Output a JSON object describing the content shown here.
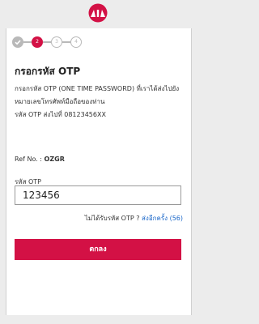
{
  "brand": {
    "accent": "#d31145",
    "link": "#1a67c9",
    "logo": "aia-logo-icon"
  },
  "stepper": {
    "steps": [
      {
        "label": "",
        "state": "done",
        "icon": "check-icon"
      },
      {
        "label": "2",
        "state": "active"
      },
      {
        "label": "3",
        "state": "todo"
      },
      {
        "label": "4",
        "state": "todo"
      }
    ]
  },
  "page": {
    "title": "กรอกรหัส OTP",
    "description_lines": [
      "กรอกรหัส OTP (ONE TIME PASSWORD) ที่เราได้ส่งไปยัง",
      "หมายเลขโทรศัพท์มือถือของท่าน",
      "รหัส OTP ส่งไปที่ 08123456XX"
    ]
  },
  "ref": {
    "label": "Ref No. :",
    "value": "OZGR"
  },
  "otp": {
    "label": "รหัส OTP",
    "value": "123456"
  },
  "resend": {
    "prompt": "ไม่ได้รับรหัส OTP ?",
    "link_label": "ส่งอีกครั้ง (56)"
  },
  "actions": {
    "submit_label": "ตกลง"
  }
}
